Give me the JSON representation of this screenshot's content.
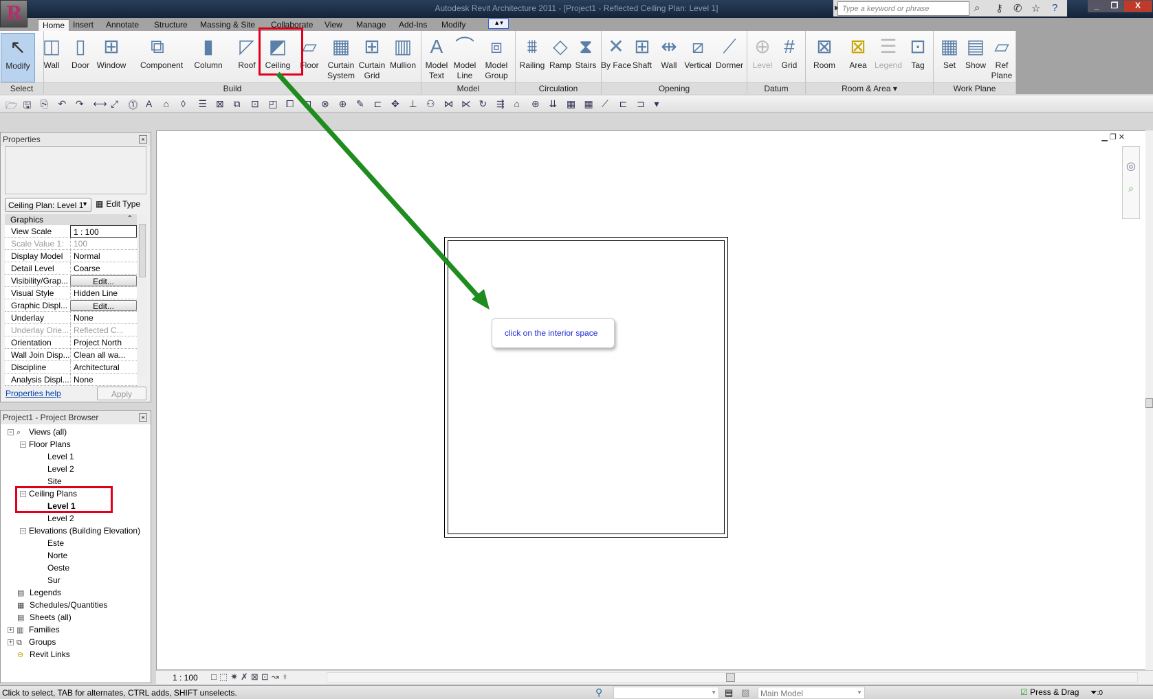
{
  "window": {
    "title": "Autodesk Revit Architecture 2011 - [Project1 - Reflected Ceiling Plan: Level 1]",
    "search_placeholder": "Type a keyword or phrase",
    "app_letter": "R"
  },
  "tabs": [
    "Home",
    "Insert",
    "Annotate",
    "Structure",
    "Massing & Site",
    "Collaborate",
    "View",
    "Manage",
    "Add-Ins",
    "Modify"
  ],
  "ribbon": {
    "panels": [
      "Select",
      "Build",
      "Model",
      "Circulation",
      "Opening",
      "Datum",
      "Room & Area ▾",
      "Work Plane"
    ],
    "buttons": [
      {
        "label": "Modify",
        "icon": "cursor-icon"
      },
      {
        "label": "Wall",
        "icon": "wall-icon"
      },
      {
        "label": "Door",
        "icon": "door-icon"
      },
      {
        "label": "Window",
        "icon": "window-icon"
      },
      {
        "label": "Component",
        "icon": "component-icon"
      },
      {
        "label": "Column",
        "icon": "column-icon"
      },
      {
        "label": "Roof",
        "icon": "roof-icon"
      },
      {
        "label": "Ceiling",
        "icon": "ceiling-icon"
      },
      {
        "label": "Floor",
        "icon": "floor-icon"
      },
      {
        "label": "Curtain System",
        "icon": "curtain-system-icon"
      },
      {
        "label": "Curtain Grid",
        "icon": "curtain-grid-icon"
      },
      {
        "label": "Mullion",
        "icon": "mullion-icon"
      },
      {
        "label": "Model Text",
        "icon": "model-text-icon"
      },
      {
        "label": "Model Line",
        "icon": "model-line-icon"
      },
      {
        "label": "Model Group",
        "icon": "model-group-icon"
      },
      {
        "label": "Railing",
        "icon": "railing-icon"
      },
      {
        "label": "Ramp",
        "icon": "ramp-icon"
      },
      {
        "label": "Stairs",
        "icon": "stairs-icon"
      },
      {
        "label": "By Face",
        "icon": "by-face-icon"
      },
      {
        "label": "Shaft",
        "icon": "shaft-icon"
      },
      {
        "label": "Wall",
        "icon": "wall-opening-icon"
      },
      {
        "label": "Vertical",
        "icon": "vertical-icon"
      },
      {
        "label": "Dormer",
        "icon": "dormer-icon"
      },
      {
        "label": "Level",
        "icon": "level-icon"
      },
      {
        "label": "Grid",
        "icon": "grid-icon"
      },
      {
        "label": "Room",
        "icon": "room-icon"
      },
      {
        "label": "Area",
        "icon": "area-icon"
      },
      {
        "label": "Legend",
        "icon": "legend-icon"
      },
      {
        "label": "Tag",
        "icon": "tag-icon"
      },
      {
        "label": "Set",
        "icon": "set-icon"
      },
      {
        "label": "Show",
        "icon": "show-icon"
      },
      {
        "label": "Ref Plane",
        "icon": "ref-plane-icon"
      }
    ]
  },
  "properties": {
    "title": "Properties",
    "type_selector": "Ceiling Plan: Level 1",
    "edit_type": "Edit Type",
    "group": "Graphics",
    "rows": [
      {
        "k": "View Scale",
        "v": "1 : 100"
      },
      {
        "k": "Scale Value    1:",
        "v": "100"
      },
      {
        "k": "Display Model",
        "v": "Normal"
      },
      {
        "k": "Detail Level",
        "v": "Coarse"
      },
      {
        "k": "Visibility/Grap...",
        "v": "Edit..."
      },
      {
        "k": "Visual Style",
        "v": "Hidden Line"
      },
      {
        "k": "Graphic Displ...",
        "v": "Edit..."
      },
      {
        "k": "Underlay",
        "v": "None"
      },
      {
        "k": "Underlay Orie...",
        "v": "Reflected C..."
      },
      {
        "k": "Orientation",
        "v": "Project North"
      },
      {
        "k": "Wall Join Disp...",
        "v": "Clean all wa..."
      },
      {
        "k": "Discipline",
        "v": "Architectural"
      },
      {
        "k": "Analysis Displ...",
        "v": "None"
      }
    ],
    "help": "Properties help",
    "apply": "Apply"
  },
  "browser": {
    "title": "Project1 - Project Browser",
    "items": [
      "Views (all)",
      "Floor Plans",
      "Level 1",
      "Level 2",
      "Site",
      "Ceiling Plans",
      "Level 1",
      "Level 2",
      "Elevations (Building Elevation)",
      "Este",
      "Norte",
      "Oeste",
      "Sur",
      "Legends",
      "Schedules/Quantities",
      "Sheets (all)",
      "Families",
      "Groups",
      "Revit Links"
    ]
  },
  "canvas": {
    "tooltip": "click on the interior space",
    "scale": "1 : 100"
  },
  "status": {
    "message": "Click to select, TAB for alternates, CTRL adds, SHIFT unselects.",
    "workset": "Main Model",
    "press_drag": "Press & Drag",
    "filter_count": ":0"
  },
  "colors": {
    "highlight": "#e0001b",
    "arrow": "#1e8c1e",
    "link": "#1a2ad8"
  }
}
